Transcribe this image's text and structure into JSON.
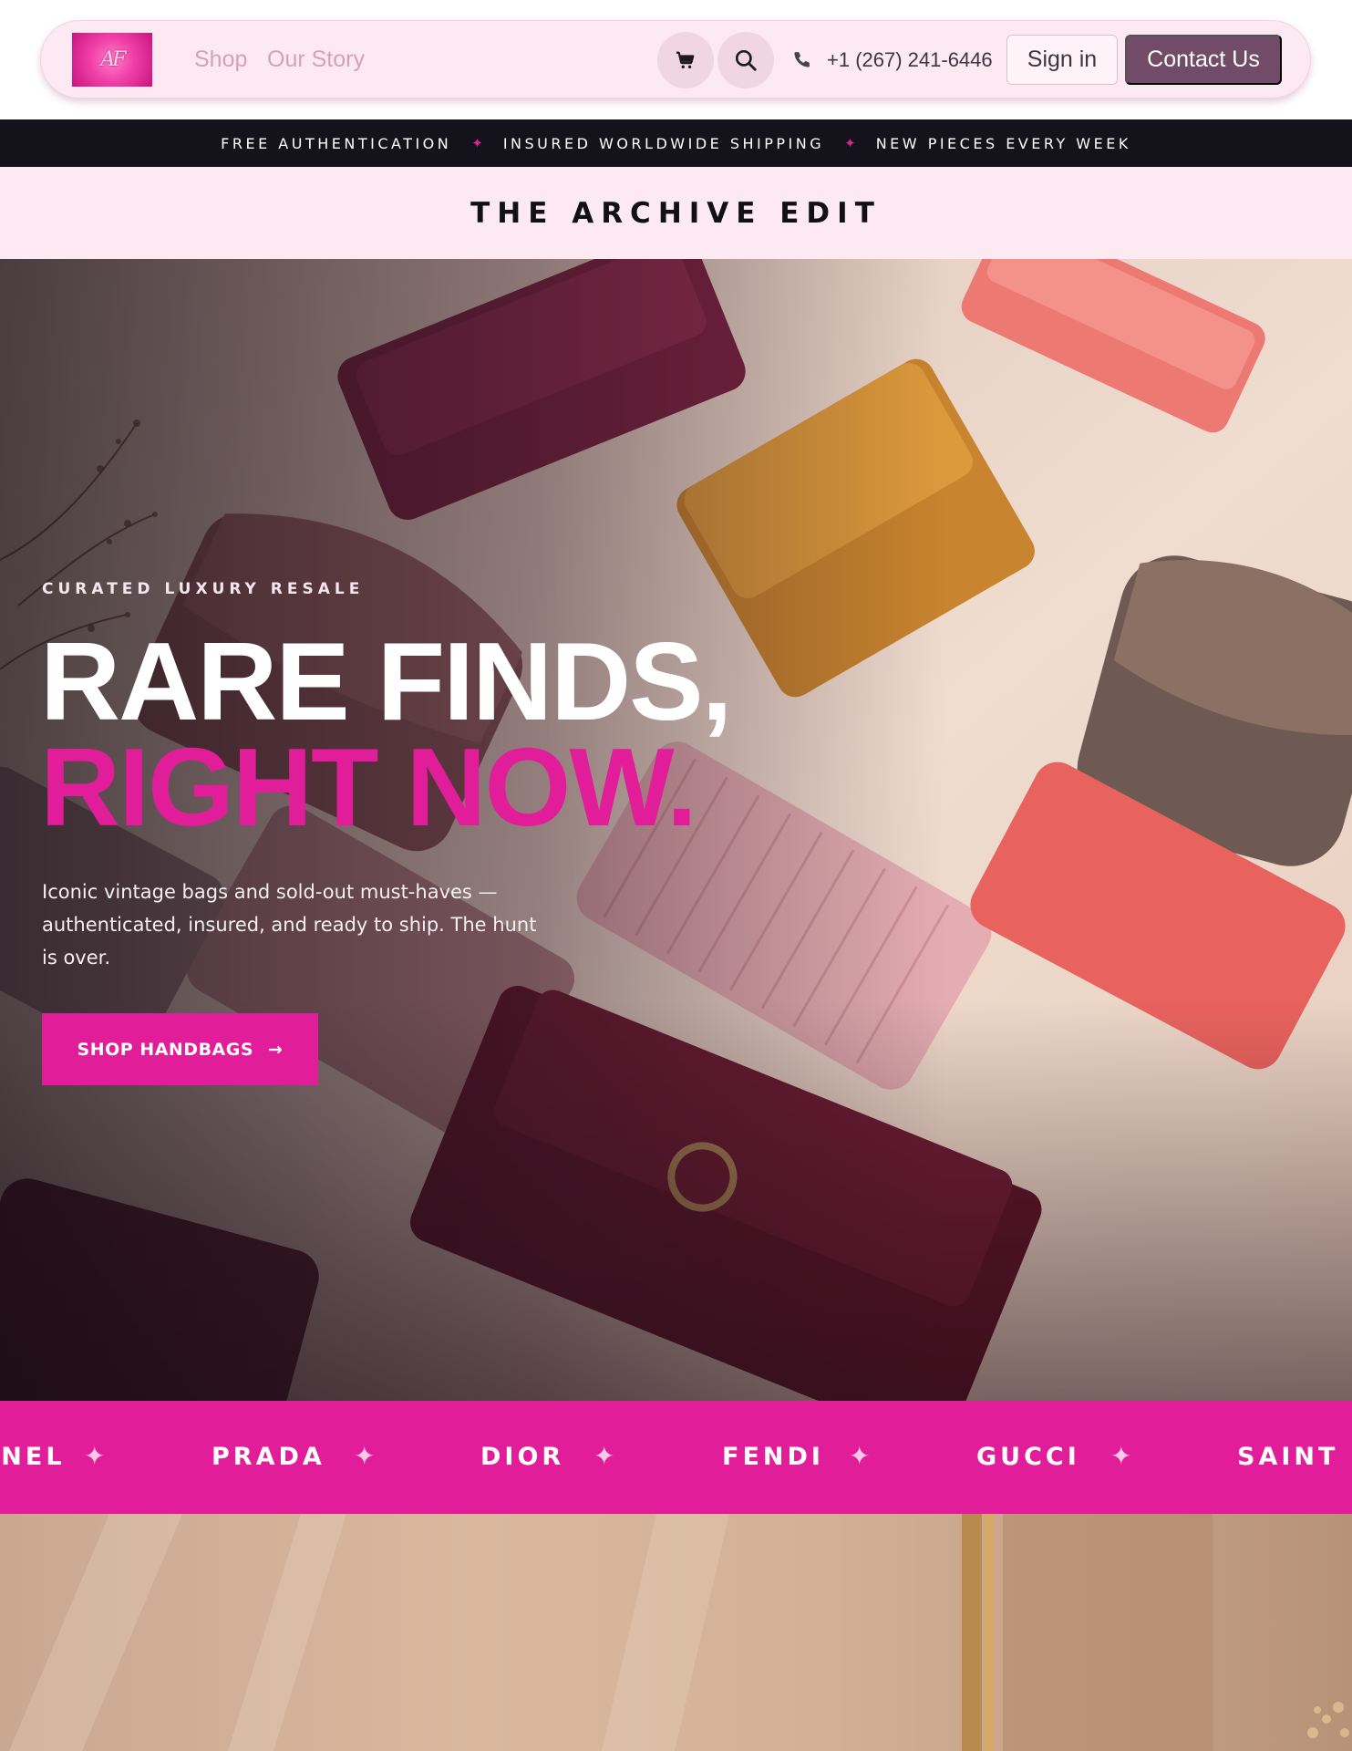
{
  "header": {
    "logo_text": "AF",
    "nav": {
      "shop": "Shop",
      "story": "Our Story"
    },
    "phone": "+1 (267) 241-6446",
    "signin": "Sign in",
    "contact": "Contact Us",
    "icons": [
      "cart-icon",
      "search-icon",
      "phone-icon"
    ]
  },
  "announcement": {
    "items": [
      "FREE AUTHENTICATION",
      "INSURED WORLDWIDE SHIPPING",
      "NEW PIECES EVERY WEEK"
    ],
    "separator": "✦"
  },
  "edit_band": {
    "title": "THE ARCHIVE EDIT"
  },
  "hero": {
    "eyebrow": "CURATED LUXURY RESALE",
    "headline_line1": "RARE FINDS,",
    "headline_line2": "RIGHT NOW.",
    "description": "Iconic vintage bags and sold-out must-haves — authenticated, insured, and ready to ship. The hunt is over.",
    "cta_label": "SHOP HANDBAGS",
    "cta_arrow": "→"
  },
  "brands": {
    "items": [
      "CHANEL",
      "PRADA",
      "DIOR",
      "FENDI",
      "GUCCI",
      "SAINT LAURENT"
    ],
    "separator": "✦"
  },
  "colors": {
    "accent": "#e11d9a",
    "nav_bg": "#fde9f2",
    "contact_bg": "#724b68",
    "announce_bg": "#14121a"
  }
}
